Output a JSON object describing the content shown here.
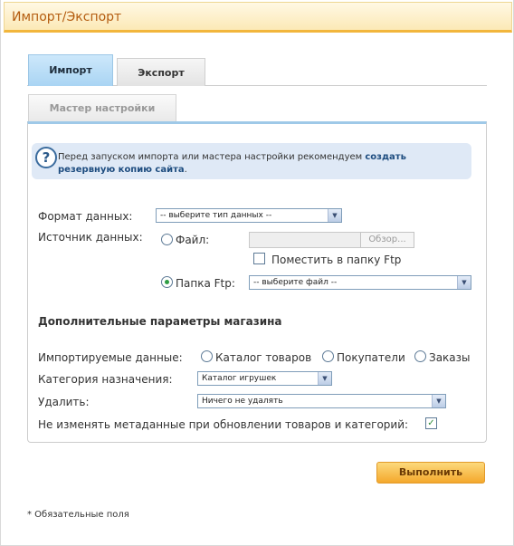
{
  "header": {
    "title": "Импорт/Экспорт"
  },
  "tabs": [
    {
      "label": "Импорт",
      "active": true
    },
    {
      "label": "Экспорт",
      "active": false
    }
  ],
  "subtabs": [
    {
      "label": "Мастер настройки"
    }
  ],
  "info": {
    "icon": "question-icon",
    "text": "Перед запуском импорта или мастера настройки рекомендуем ",
    "link": "создать резервную копию сайта",
    "suffix": "."
  },
  "form": {
    "format": {
      "label": "Формат данных:",
      "value": "-- выберите тип данных --"
    },
    "source": {
      "label": "Источник данных:",
      "file_label": "Файл:",
      "browse_label": "Обзор...",
      "ftp_folder_checkbox": "Поместить в папку Ftp",
      "ftp_label": "Папка Ftp:",
      "ftp_value": "-- выберите файл --",
      "selected": "ftp"
    }
  },
  "extra": {
    "title": "Дополнительные параметры магазина",
    "imported": {
      "label": "Импортируемые данные:",
      "options": [
        "Каталог товаров",
        "Покупатели",
        "Заказы"
      ]
    },
    "category": {
      "label": "Категория назначения:",
      "value": "Каталог игрушек"
    },
    "delete": {
      "label": "Удалить:",
      "value": "Ничего не удалять"
    },
    "keep_meta": {
      "label": "Не изменять метаданные при обновлении товаров и категорий:",
      "checked": true
    }
  },
  "actions": {
    "run_label": "Выполнить"
  },
  "footer": {
    "required_note": "* Обязательные поля"
  },
  "colors": {
    "accent": "#f2b63c",
    "title": "#b45c10",
    "tab_active": "#a9d4f3",
    "info_bg": "#dfe9f6"
  }
}
